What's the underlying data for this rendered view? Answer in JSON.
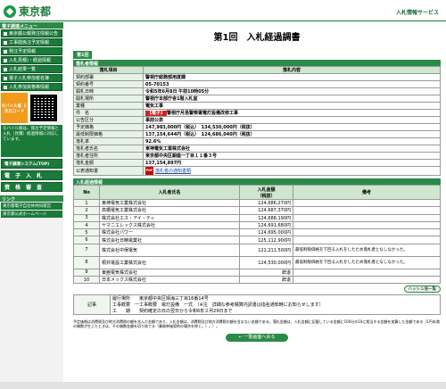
{
  "header": {
    "logo_text": "東京都",
    "service_title": "入札情報サービス"
  },
  "sidebar": {
    "section_title": "電子調達メニュー",
    "menu": [
      "東京都公報発注情報公告",
      "工事関係注予定情報",
      "発注予定情報",
      "入札見積)・経過情報",
      "入札結果一覧",
      "電子入札参加者名簿",
      "入札参加資格等情報"
    ],
    "mobile_label": "モバイル版 ２次元コード",
    "note": "モバイル版は、発注予定情報と入札（見積）経過情報に対応しています。",
    "big_buttons": [
      "電子調達システム(TOP)",
      "電　子　入　札",
      "資　格　審　査"
    ],
    "links_title": "リンク",
    "links": [
      "東京都電子自治体共同運営",
      "東京都公式ホームページ"
    ]
  },
  "main": {
    "title": "第1回　入札経過調書",
    "tab": "第1回",
    "info_bar": "落札者情報",
    "info_headers": [
      "落札項目",
      "落札内容"
    ],
    "info_rows": [
      {
        "label": "契約部署",
        "value": "警視庁総務部用度課"
      },
      {
        "label": "契約番号",
        "value": "05-70153"
      },
      {
        "label": "開札日時",
        "value": "令和5年6月8日 午前10時05分"
      },
      {
        "label": "開札場所",
        "value": "警視庁本部庁舎1階入札室"
      },
      {
        "label": "業種",
        "value": "電気工事"
      },
      {
        "label": "件　名",
        "value_tag": "【電子】",
        "value": "警視庁月島警察署電灯設備改修工事"
      },
      {
        "label": "公告区分",
        "value": "事前公表"
      },
      {
        "label": "予定価格",
        "value": "147,983,000円（税込）　134,530,000円（税抜）"
      },
      {
        "label": "最低制限価格",
        "value": "137,154,644円（税込）　124,686,040円（税抜）"
      },
      {
        "label": "落札率",
        "value": "92.6%"
      },
      {
        "label": "落札者氏名",
        "value": "東神電気工業株式会社"
      },
      {
        "label": "落札者住所",
        "value": "東京都中央区銀座一丁目１１番３号"
      },
      {
        "label": "落札金額",
        "value": "137,154,897円"
      },
      {
        "label": "公表通知書",
        "pdf": "PDF",
        "value": "落札者の通知書類"
      }
    ],
    "bidders_bar": "入札経過情報",
    "bidders_headers": [
      "No",
      "入札者氏名",
      "入札金額\n（税抜）",
      "備考"
    ],
    "bidders": [
      {
        "no": "1",
        "name": "東神電気工業株式会社",
        "amount": "124,686,270円",
        "note": ""
      },
      {
        "no": "2",
        "name": "高橋電気工業株式会社",
        "amount": "124,687,370円",
        "note": ""
      },
      {
        "no": "3",
        "name": "株式会社エス・アイ・ティ",
        "amount": "124,688,190円",
        "note": ""
      },
      {
        "no": "4",
        "name": "ヤマニエレックス株式会社",
        "amount": "124,691,680円",
        "note": ""
      },
      {
        "no": "5",
        "name": "株式会社パワー",
        "amount": "124,695,000円",
        "note": ""
      },
      {
        "no": "6",
        "name": "株式会社日精電業社",
        "amount": "125,112,900円",
        "note": ""
      },
      {
        "no": "7",
        "name": "株式会社中俣電気",
        "amount": "121,211,500円",
        "note": "最低制限価格を下回る入札をしたため落札者となしなかった。"
      },
      {
        "no": "8",
        "name": "桐井電設工業株式会社",
        "amount": "124,530,000円",
        "note": "最低制限価格を下回る入札をしたため落札者となしなかった。"
      },
      {
        "no": "9",
        "name": "東亜電気株式会社",
        "amount": "辞退",
        "note": ""
      },
      {
        "no": "10",
        "name": "日本メックス株式会社",
        "amount": "辞退",
        "note": ""
      }
    ],
    "history_button": "ハッシュ値一覧",
    "remarks_label": "記事",
    "remarks": [
      "履行場所　　東京都中央区晴海三丁目16番14号",
      "工事概要　一工事概要　電灯設備　一式　（※注　詳細な参考積算内訳書は指名通知時にお知らせします）",
      "工　　期　　契約確定の日の翌日から令和6年２月29日まで"
    ],
    "footnote": "予定価格は消費税及び地方消費税の額を含んだ金額であり、入札金額は、消費税及び地方消費税の額を含まない金額である。落札金額は、入札金額に記載している金額に100分の10に相当する金額を加算した金額である（1円未満の端数が生じたときは、その端数金額を切り捨てる（業務単価契約の場合を除く。）。）。",
    "back_button": "← 一覧画面へ戻る"
  }
}
